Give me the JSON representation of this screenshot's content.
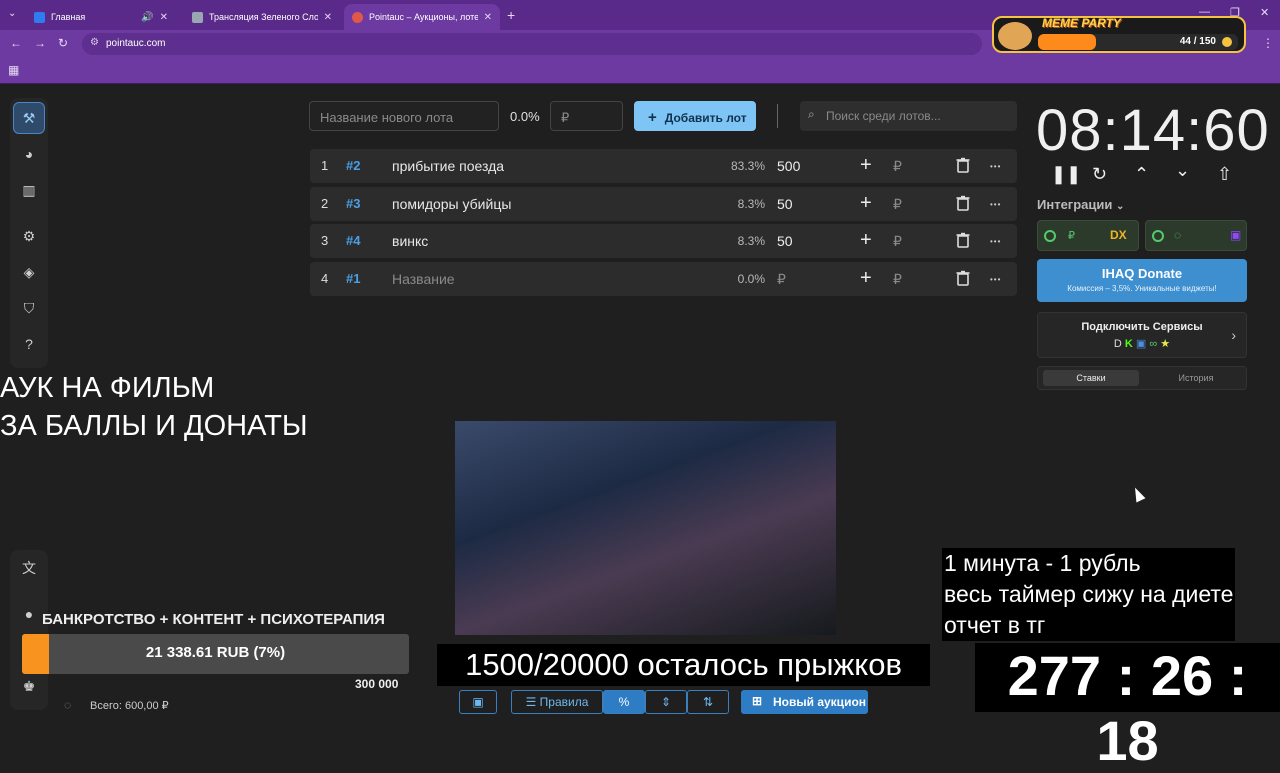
{
  "browser": {
    "tabs": [
      {
        "label": "Главная",
        "favicon_color": "#2f7bf0"
      },
      {
        "label": "Трансляция Зеленого Слоника",
        "favicon_color": "#9aa7b3"
      },
      {
        "label": "Pointauc – Аукционы, лотереи",
        "favicon_color": "#e0584a"
      }
    ],
    "url": "pointauc.com",
    "new_tab": "+"
  },
  "meme_party": {
    "title": "MEME PARTY",
    "count": "44 / 150",
    "progress": 0.29
  },
  "lot_form": {
    "name_placeholder": "Название нового лота",
    "percent": "0.0%",
    "amount_placeholder": "₽",
    "add_button": "Добавить лот",
    "search_placeholder": "Поиск среди лотов..."
  },
  "lots": [
    {
      "num": "1",
      "id": "#2",
      "name": "прибытие поезда",
      "pct": "83.3%",
      "amount": "500",
      "placeholder": false
    },
    {
      "num": "2",
      "id": "#3",
      "name": "помидоры убийцы",
      "pct": "8.3%",
      "amount": "50",
      "placeholder": false
    },
    {
      "num": "3",
      "id": "#4",
      "name": "винкс",
      "pct": "8.3%",
      "amount": "50",
      "placeholder": false
    },
    {
      "num": "4",
      "id": "#1",
      "name": "Название",
      "pct": "0.0%",
      "amount": "₽",
      "placeholder": true
    }
  ],
  "rub_symbol": "₽",
  "timer": {
    "value": "08:14:60"
  },
  "integrations": {
    "label": "Интеграции"
  },
  "ihaq": {
    "title": "IHAQ Donate",
    "subtitle": "Комиссия – 3,5%. Уникальные виджеты!"
  },
  "connect": {
    "title": "Подключить Сервисы"
  },
  "bet_tabs": {
    "bets": "Ставки",
    "history": "История"
  },
  "overlay": {
    "title_line1": "АУК НА ФИЛЬМ",
    "title_line2": "ЗА БАЛЛЫ И ДОНАТЫ",
    "jumps": "1500/20000 осталось прыжков",
    "rule_line1": "1 минута - 1 рубль",
    "rule_line2": "весь таймер сижу на диете",
    "rule_line3": "отчет в тг",
    "big_timer": "277 : 26 : 18"
  },
  "donation_goal": {
    "title": "БАНКРОТСТВО + КОНТЕНТ + ПСИХОТЕРАПИЯ",
    "progress_text": "21 338.61 RUB (7%)",
    "progress": 0.07,
    "target": "300 000",
    "total": "Всего: 600,00 ₽"
  },
  "toolbar": {
    "rules": "Правила",
    "new_auction": "Новый аукцион"
  },
  "colors": {
    "accent": "#7ec4f5",
    "browser": "#6c3aa0",
    "goal_fill": "#f7931e"
  }
}
